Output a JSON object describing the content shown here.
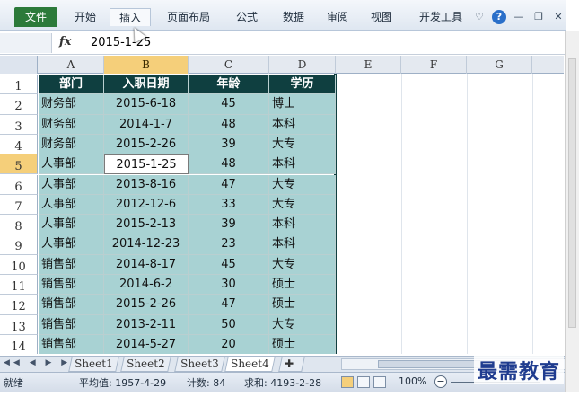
{
  "ribbon": {
    "tabs": [
      "文件",
      "开始",
      "插入",
      "页面布局",
      "公式",
      "数据",
      "审阅",
      "视图",
      "开发工具"
    ],
    "active_tab": "插入",
    "icons": [
      "heart-icon",
      "help-icon",
      "minimize-icon",
      "restore-icon",
      "close-icon"
    ]
  },
  "formula_bar": {
    "fx_label": "fx",
    "value": "2015-1-25"
  },
  "columns": [
    "A",
    "B",
    "C",
    "D",
    "E",
    "F",
    "G"
  ],
  "selected_column": "B",
  "rows": [
    "1",
    "2",
    "3",
    "4",
    "5",
    "6",
    "7",
    "8",
    "9",
    "10",
    "11",
    "12",
    "13",
    "14"
  ],
  "selected_row": "5",
  "table": {
    "headers": [
      "部门",
      "入职日期",
      "年龄",
      "学历"
    ],
    "rows": [
      [
        "财务部",
        "2015-6-18",
        "45",
        "博士"
      ],
      [
        "财务部",
        "2014-1-7",
        "48",
        "本科"
      ],
      [
        "财务部",
        "2015-2-26",
        "39",
        "大专"
      ],
      [
        "人事部",
        "2015-1-25",
        "48",
        "本科"
      ],
      [
        "人事部",
        "2013-8-16",
        "47",
        "大专"
      ],
      [
        "人事部",
        "2012-12-6",
        "33",
        "大专"
      ],
      [
        "人事部",
        "2015-2-13",
        "39",
        "本科"
      ],
      [
        "人事部",
        "2014-12-23",
        "23",
        "本科"
      ],
      [
        "销售部",
        "2014-8-17",
        "45",
        "大专"
      ],
      [
        "销售部",
        "2014-6-2",
        "30",
        "硕士"
      ],
      [
        "销售部",
        "2015-2-26",
        "47",
        "硕士"
      ],
      [
        "销售部",
        "2013-2-11",
        "50",
        "大专"
      ],
      [
        "销售部",
        "2014-5-27",
        "20",
        "硕士"
      ]
    ],
    "active_cell_row": 3
  },
  "sheets": [
    "Sheet1",
    "Sheet2",
    "Sheet3",
    "Sheet4"
  ],
  "active_sheet": "Sheet4",
  "status": {
    "mode": "就绪",
    "average": "平均值: 1957-4-29",
    "count": "计数: 84",
    "sum": "求和: 4193-2-28",
    "zoom": "100%"
  },
  "watermark": "最需教育",
  "colors": {
    "header_bg": "#0f3f40",
    "body_bg": "#a8d2d3",
    "file_tab": "#2c7a3a",
    "selection": "#f5cf7a"
  }
}
